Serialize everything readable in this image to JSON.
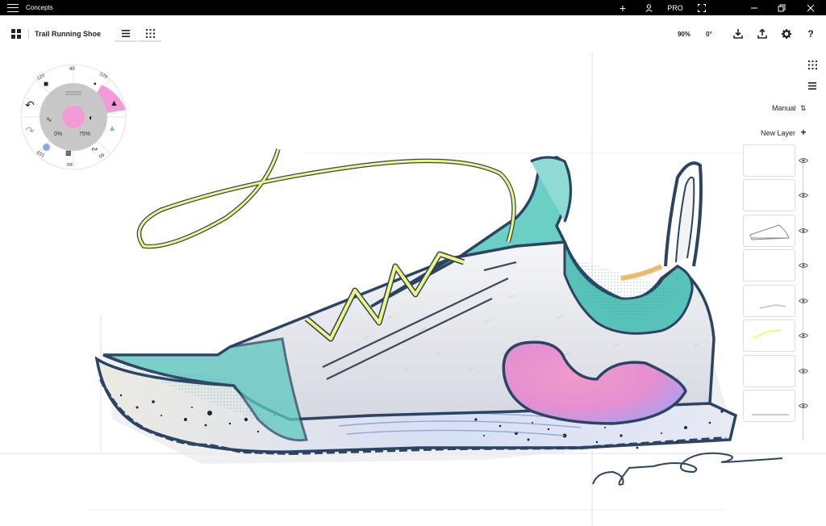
{
  "titlebar": {
    "title": "Concepts",
    "pro_label": "PRO",
    "plus_label": "+"
  },
  "toolbar": {
    "document_title": "Trail Running Shoe",
    "zoom": "90%",
    "rotation": "0°"
  },
  "radial_menu": {
    "top_size": "40",
    "left_top_size": "120",
    "right_top_size": "120",
    "left_bottom_size": "103",
    "bottom_size": "60",
    "right_bottom_size": "60",
    "opacity": "0%",
    "smoothing": "75%",
    "accent_color": "#f59ad8"
  },
  "layers": {
    "sort_label": "Manual",
    "new_layer_label": "New Layer",
    "count": 8
  },
  "colors": {
    "ink": "#2c4463",
    "teal": "#5cc8c0",
    "yellow": "#f1f57a",
    "pink": "#ee8ec4",
    "violet": "#b79bf0"
  }
}
